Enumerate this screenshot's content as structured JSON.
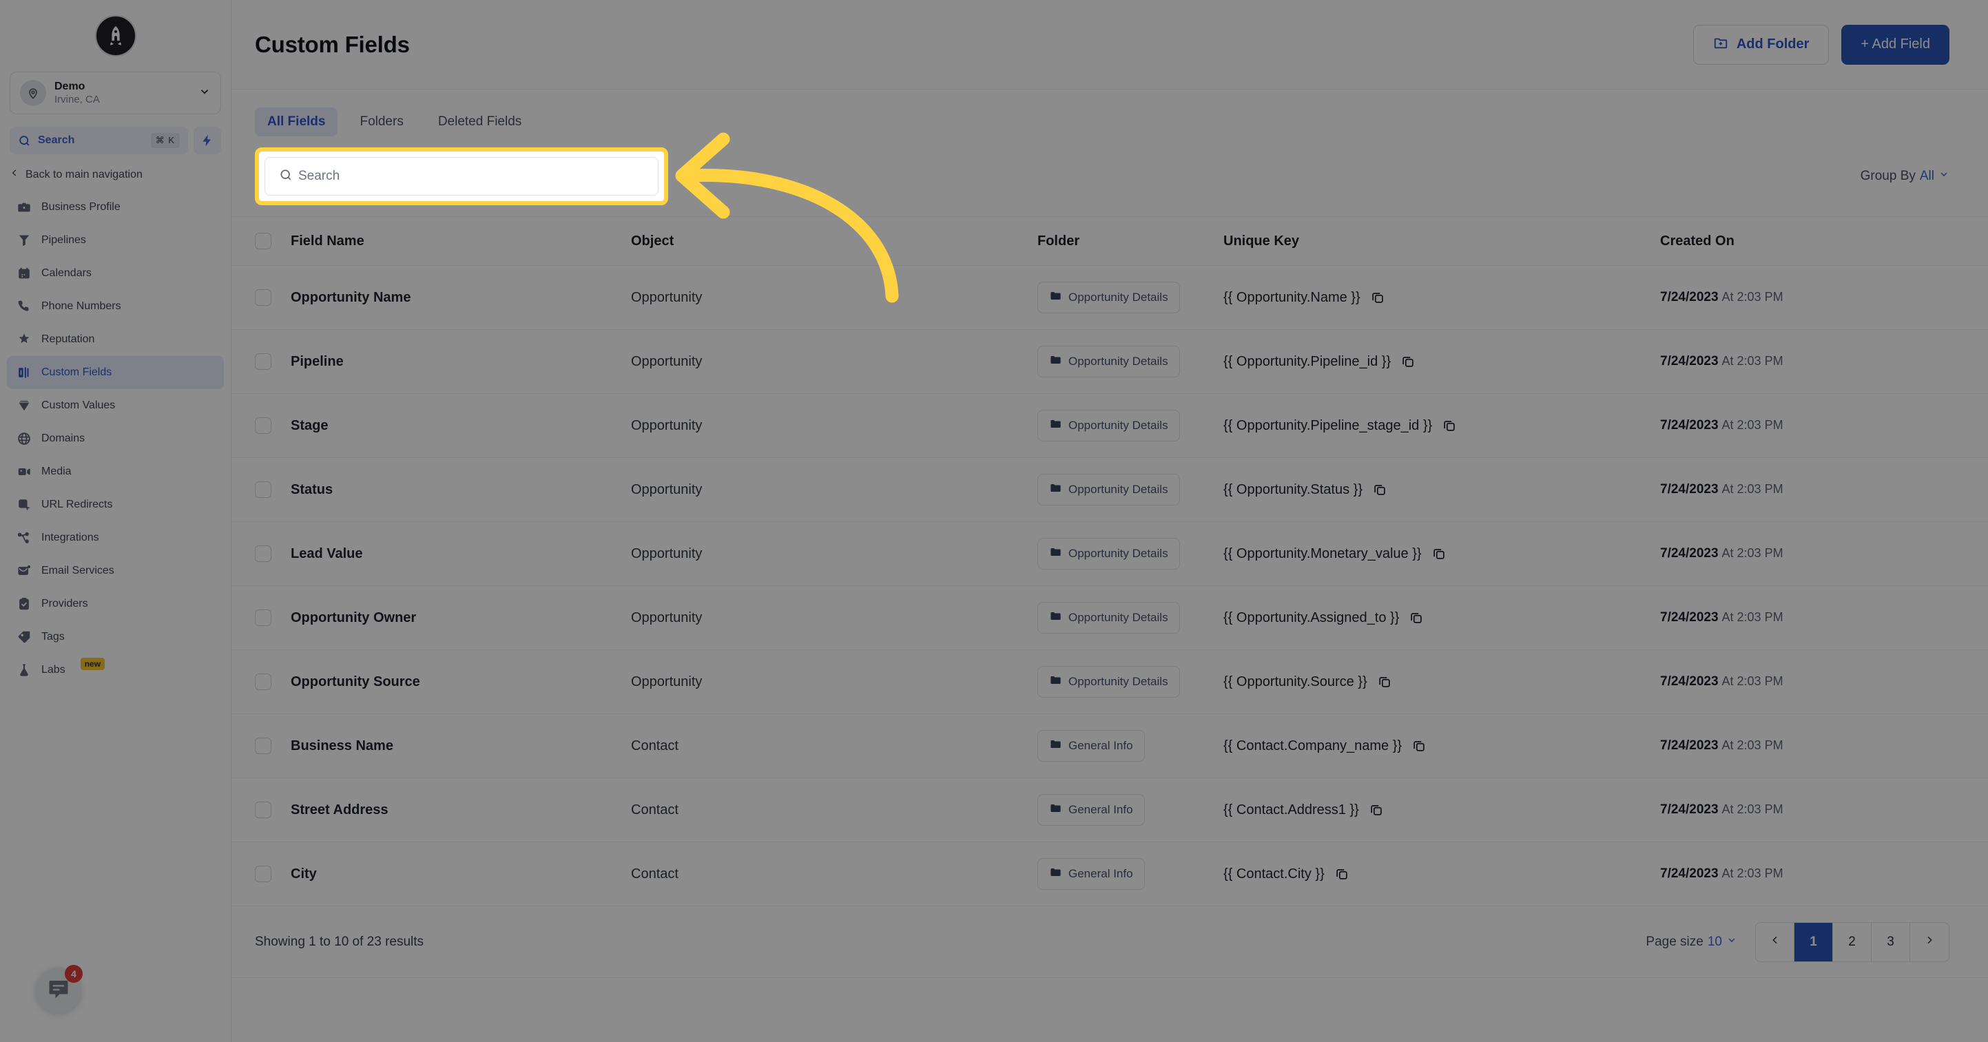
{
  "sidebar": {
    "logo_icon": "rocket-logo-icon",
    "location": {
      "name": "Demo",
      "sub": "Irvine, CA",
      "avatar_icon": "location-pin-icon",
      "chevron_icon": "chevron-down-icon"
    },
    "quick_search": {
      "label": "Search",
      "shortcut": "⌘ K",
      "icon": "search-icon",
      "bolt_icon": "lightning-bolt-icon"
    },
    "back_nav": {
      "label": "Back to main navigation",
      "icon": "chevron-left-icon"
    },
    "items": [
      {
        "label": "Business Profile",
        "icon": "briefcase-icon",
        "active": false
      },
      {
        "label": "Pipelines",
        "icon": "funnel-icon",
        "active": false
      },
      {
        "label": "Calendars",
        "icon": "calendar-icon",
        "active": false
      },
      {
        "label": "Phone Numbers",
        "icon": "phone-icon",
        "active": false
      },
      {
        "label": "Reputation",
        "icon": "star-icon",
        "active": false
      },
      {
        "label": "Custom Fields",
        "icon": "fields-icon",
        "active": true
      },
      {
        "label": "Custom Values",
        "icon": "diamond-icon",
        "active": false
      },
      {
        "label": "Domains",
        "icon": "globe-icon",
        "active": false
      },
      {
        "label": "Media",
        "icon": "video-icon",
        "active": false
      },
      {
        "label": "URL Redirects",
        "icon": "cursor-box-icon",
        "active": false
      },
      {
        "label": "Integrations",
        "icon": "nodes-icon",
        "active": false
      },
      {
        "label": "Email Services",
        "icon": "mail-icon",
        "active": false
      },
      {
        "label": "Providers",
        "icon": "clipboard-check-icon",
        "active": false
      },
      {
        "label": "Tags",
        "icon": "tag-icon",
        "active": false
      },
      {
        "label": "Labs",
        "icon": "flask-icon",
        "active": false,
        "badge": "new"
      }
    ],
    "chat": {
      "icon": "chat-bubble-icon",
      "count": "4"
    }
  },
  "header": {
    "title": "Custom Fields",
    "add_folder_label": "Add Folder",
    "add_folder_icon": "folder-plus-icon",
    "add_field_label": "+ Add Field"
  },
  "tabs": [
    {
      "label": "All Fields",
      "active": true
    },
    {
      "label": "Folders",
      "active": false
    },
    {
      "label": "Deleted Fields",
      "active": false
    }
  ],
  "search": {
    "placeholder": "Search",
    "value": "",
    "icon": "search-icon",
    "highlight_color": "#ffd242"
  },
  "group_by": {
    "label": "Group By",
    "value": "All",
    "icon": "chevron-down-icon"
  },
  "table": {
    "columns": [
      "Field Name",
      "Object",
      "Folder",
      "Unique Key",
      "Created On"
    ],
    "rows": [
      {
        "name": "Opportunity Name",
        "object": "Opportunity",
        "folder": "Opportunity Details",
        "key": "{{ Opportunity.Name }}",
        "date": "7/24/2023",
        "time": "At 2:03 PM"
      },
      {
        "name": "Pipeline",
        "object": "Opportunity",
        "folder": "Opportunity Details",
        "key": "{{ Opportunity.Pipeline_id }}",
        "date": "7/24/2023",
        "time": "At 2:03 PM"
      },
      {
        "name": "Stage",
        "object": "Opportunity",
        "folder": "Opportunity Details",
        "key": "{{ Opportunity.Pipeline_stage_id }}",
        "date": "7/24/2023",
        "time": "At 2:03 PM"
      },
      {
        "name": "Status",
        "object": "Opportunity",
        "folder": "Opportunity Details",
        "key": "{{ Opportunity.Status }}",
        "date": "7/24/2023",
        "time": "At 2:03 PM"
      },
      {
        "name": "Lead Value",
        "object": "Opportunity",
        "folder": "Opportunity Details",
        "key": "{{ Opportunity.Monetary_value }}",
        "date": "7/24/2023",
        "time": "At 2:03 PM"
      },
      {
        "name": "Opportunity Owner",
        "object": "Opportunity",
        "folder": "Opportunity Details",
        "key": "{{ Opportunity.Assigned_to }}",
        "date": "7/24/2023",
        "time": "At 2:03 PM"
      },
      {
        "name": "Opportunity Source",
        "object": "Opportunity",
        "folder": "Opportunity Details",
        "key": "{{ Opportunity.Source }}",
        "date": "7/24/2023",
        "time": "At 2:03 PM"
      },
      {
        "name": "Business Name",
        "object": "Contact",
        "folder": "General Info",
        "key": "{{ Contact.Company_name }}",
        "date": "7/24/2023",
        "time": "At 2:03 PM"
      },
      {
        "name": "Street Address",
        "object": "Contact",
        "folder": "General Info",
        "key": "{{ Contact.Address1 }}",
        "date": "7/24/2023",
        "time": "At 2:03 PM"
      },
      {
        "name": "City",
        "object": "Contact",
        "folder": "General Info",
        "key": "{{ Contact.City }}",
        "date": "7/24/2023",
        "time": "At 2:03 PM"
      }
    ]
  },
  "footer": {
    "showing": "Showing 1 to 10 of 23 results",
    "page_size_label": "Page size",
    "page_size_value": "10",
    "pages": [
      "1",
      "2",
      "3"
    ],
    "active_page": "1",
    "prev_icon": "chevron-left-icon",
    "next_icon": "chevron-right-icon"
  },
  "annotation": {
    "arrow_color": "#ffd242",
    "arrow_icon": "curved-left-arrow-annotation"
  }
}
